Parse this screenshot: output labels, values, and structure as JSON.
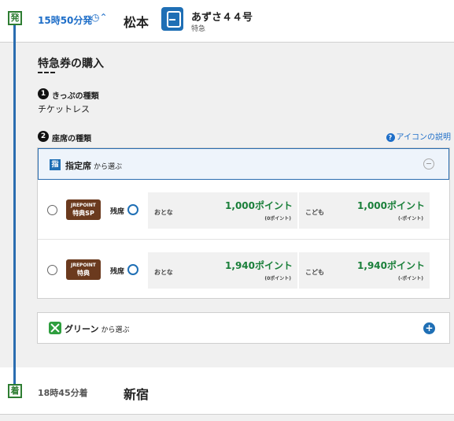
{
  "departure": {
    "badge": "発",
    "time": "15時50分発",
    "station": "松本"
  },
  "train": {
    "name": "あずさ４４号",
    "type": "特急"
  },
  "purchase": {
    "title": "特急券の購入",
    "ticket_type_label": "きっぷの種類",
    "ticket_type_value": "チケットレス",
    "seat_type_label": "座席の種類",
    "help_link": "アイコンの説明",
    "reserved_seat": {
      "icon": "指",
      "title": "指定席",
      "sub": "から選ぶ",
      "options": [
        {
          "badge_line1": "JREPOINT",
          "badge_line2": "特典SP",
          "availability": "残席",
          "adult_label": "おとな",
          "adult_price": "1,000ポイント",
          "adult_sub": "(0ポイント)",
          "child_label": "こども",
          "child_price": "1,000ポイント",
          "child_sub": "(-ポイント)"
        },
        {
          "badge_line1": "JREPOINT",
          "badge_line2": "特典",
          "availability": "残席",
          "adult_label": "おとな",
          "adult_price": "1,940ポイント",
          "adult_sub": "(0ポイント)",
          "child_label": "こども",
          "child_price": "1,940ポイント",
          "child_sub": "(-ポイント)"
        }
      ]
    },
    "green_seat": {
      "title": "グリーン",
      "sub": "から選ぶ"
    }
  },
  "arrival": {
    "badge": "着",
    "time": "18時45分着",
    "station": "新宿"
  },
  "colors": {
    "accent_blue": "#1f6fb5",
    "price_green": "#1a7f3a",
    "badge_brown": "#6b3a1e"
  }
}
